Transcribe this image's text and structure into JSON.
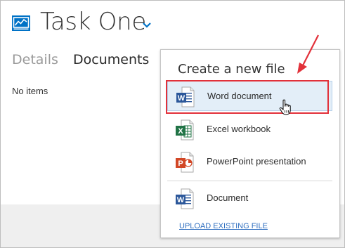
{
  "header": {
    "title": "Task One",
    "app_icon": "task-board-icon",
    "chevron_icon": "chevron-down-icon"
  },
  "tabs": [
    {
      "label": "Details",
      "active": false
    },
    {
      "label": "Documents",
      "active": true
    }
  ],
  "documents": {
    "empty_text": "No items"
  },
  "new_file_menu": {
    "title": "Create a new file",
    "items": [
      {
        "label": "Word document",
        "icon": "word-icon",
        "hovered": true
      },
      {
        "label": "Excel workbook",
        "icon": "excel-icon",
        "hovered": false
      },
      {
        "label": "PowerPoint presentation",
        "icon": "powerpoint-icon",
        "hovered": false
      },
      {
        "label": "Document",
        "icon": "word-icon",
        "hovered": false
      }
    ],
    "upload_link": "UPLOAD EXISTING FILE"
  },
  "colors": {
    "accent_blue": "#0072c6",
    "word_blue": "#2b579a",
    "excel_green": "#217346",
    "powerpoint_orange": "#d24726",
    "annotation_red": "#e2313a",
    "hover_bg": "#e3eef8",
    "link_blue": "#2f6fc0"
  }
}
